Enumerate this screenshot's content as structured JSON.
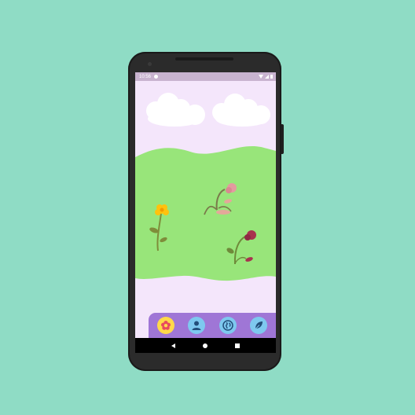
{
  "status_bar": {
    "time": "10:56"
  },
  "bottom_nav": {
    "items": [
      {
        "icon": "flower-icon",
        "active": true
      },
      {
        "icon": "person-icon",
        "active": false
      },
      {
        "icon": "globe-icon",
        "active": false
      },
      {
        "icon": "leaf-icon",
        "active": false
      }
    ]
  },
  "system_nav": {
    "icons": [
      "back-icon",
      "home-icon",
      "recents-icon"
    ]
  },
  "colors": {
    "background": "#8fdcc5",
    "sky": "#f4e6fb",
    "grass": "#98e57a",
    "nav_bar": "#9f76d6",
    "nav_button": "#7ec8ef",
    "nav_button_active": "#ffd949"
  }
}
